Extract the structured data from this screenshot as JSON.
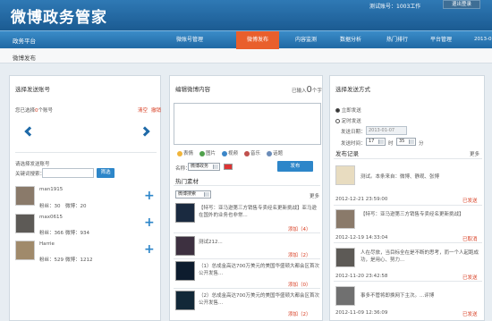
{
  "app": {
    "logo": "微博政务管家",
    "account_label": "测试账号：1003工作",
    "logout": "退出登录"
  },
  "nav": {
    "platform": "政务平台",
    "items": [
      "微账号管理",
      "微博发布",
      "内容监测",
      "数据分析",
      "热门排行",
      "平台管理"
    ],
    "active": 1,
    "date": "2013-0"
  },
  "subnav": {
    "title": "微博发布"
  },
  "left": {
    "title": "选择发送账号",
    "selected_prefix": "您已选择",
    "selected_count": "0",
    "selected_suffix": "个账号",
    "clear": "清空",
    "manage": "撤销",
    "choose_title": "请选择发送账号",
    "search_label": "关键词搜索：",
    "search_btn": "筛选",
    "accounts": [
      {
        "name": "man1915",
        "fans": "粉丝：30",
        "weibo": "微博：20"
      },
      {
        "name": "max0615",
        "fans": "粉丝：366",
        "weibo": "微博：934"
      },
      {
        "name": "Harrie",
        "fans": "粉丝：529",
        "weibo": "微博：1212"
      }
    ]
  },
  "mid": {
    "title": "编辑微博内容",
    "counter_prefix": "已输入",
    "counter_value": "0",
    "counter_suffix": "个字",
    "tools": [
      "表情",
      "图片",
      "视频",
      "音乐",
      "话题"
    ],
    "source_label": "名称：",
    "source_value": "微博政务",
    "send_btn": "发布",
    "material_title": "热门素材",
    "filter_value": "微博搜索",
    "more": "更多",
    "items": [
      {
        "text": "【特写：亚马逊第三方销售专卖经名更新挑战】亚马逊在国外的业务也非常...",
        "add": "添加（4）"
      },
      {
        "text": "测试212...",
        "add": "添加（2）"
      },
      {
        "text": "（1）总成金高达700万美元的美国华盛顿大都会区首次公开发售...",
        "add": "添加（0）"
      },
      {
        "text": "（2）总成金高达700万美元的美国华盛顿大都会区首次公开发售...",
        "add": "添加（2）"
      }
    ]
  },
  "right": {
    "title": "选择发送方式",
    "opt1": "立即发送",
    "opt2": "定时发送",
    "date_label": "发送日期：",
    "date_value": "2013-01-07",
    "time_label": "发送时间：",
    "hour": "17",
    "hour_unit": "时",
    "minute": "35",
    "minute_unit": "分",
    "record_title": "发布记录",
    "more": "更多",
    "records": [
      {
        "text": "测试。本条来自：微博、静观、张博",
        "time": "2012-12-21 23:59:00",
        "status": "已发送"
      },
      {
        "text": "【特写：亚马逊第三方销售专卖经名更新挑战】",
        "time": "2012-12-19 14:33:04",
        "status": "已取消"
      },
      {
        "text": "人在尽旅，当目标全在是不断的思考，而一个人起跑成功，是用心、努力...",
        "time": "2012-11-20 23:42:58",
        "status": "已发送"
      },
      {
        "text": "事多不管将即换网下主次。...评博",
        "time": "2012-11-09 12:36:09",
        "status": "已发送"
      }
    ]
  },
  "colors": {
    "accent": "#e95f2c",
    "nav": "#1f68a4"
  }
}
